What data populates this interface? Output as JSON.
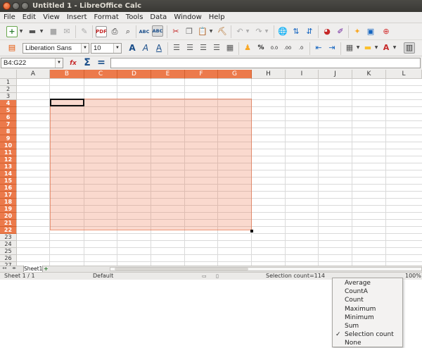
{
  "window": {
    "title": "Untitled 1 - LibreOffice Calc"
  },
  "menu": [
    "File",
    "Edit",
    "View",
    "Insert",
    "Format",
    "Tools",
    "Data",
    "Window",
    "Help"
  ],
  "toolbar_font": {
    "name": "Liberation Sans",
    "size": "10"
  },
  "formula_bar": {
    "cell_ref": "B4:G22",
    "value": ""
  },
  "columns": [
    "A",
    "B",
    "C",
    "D",
    "E",
    "F",
    "G",
    "H",
    "I",
    "J",
    "K",
    "L"
  ],
  "rows": [
    "1",
    "2",
    "3",
    "4",
    "5",
    "6",
    "7",
    "8",
    "9",
    "10",
    "11",
    "12",
    "13",
    "14",
    "15",
    "16",
    "17",
    "18",
    "19",
    "20",
    "21",
    "22",
    "23",
    "24",
    "25",
    "26",
    "27"
  ],
  "selection": {
    "range": "B4:G22",
    "selected_columns": [
      "B",
      "C",
      "D",
      "E",
      "F",
      "G"
    ],
    "selected_rows_from": 4,
    "selected_rows_to": 22
  },
  "sheet_tabs": [
    "Sheet1"
  ],
  "status": {
    "sheet": "Sheet 1 / 1",
    "style": "Default",
    "selection": "Selection count=114",
    "zoom": "100%"
  },
  "context_menu": {
    "items": [
      {
        "label": "Average",
        "checked": false
      },
      {
        "label": "CountA",
        "checked": false
      },
      {
        "label": "Count",
        "checked": false
      },
      {
        "label": "Maximum",
        "checked": false
      },
      {
        "label": "Minimum",
        "checked": false
      },
      {
        "label": "Sum",
        "checked": false
      },
      {
        "label": "Selection count",
        "checked": true
      },
      {
        "label": "None",
        "checked": false
      }
    ]
  },
  "colors": {
    "selection_header": "#ec7a4b",
    "selection_fill": "#f8cdbd",
    "titlebar": "#3c3b37"
  }
}
